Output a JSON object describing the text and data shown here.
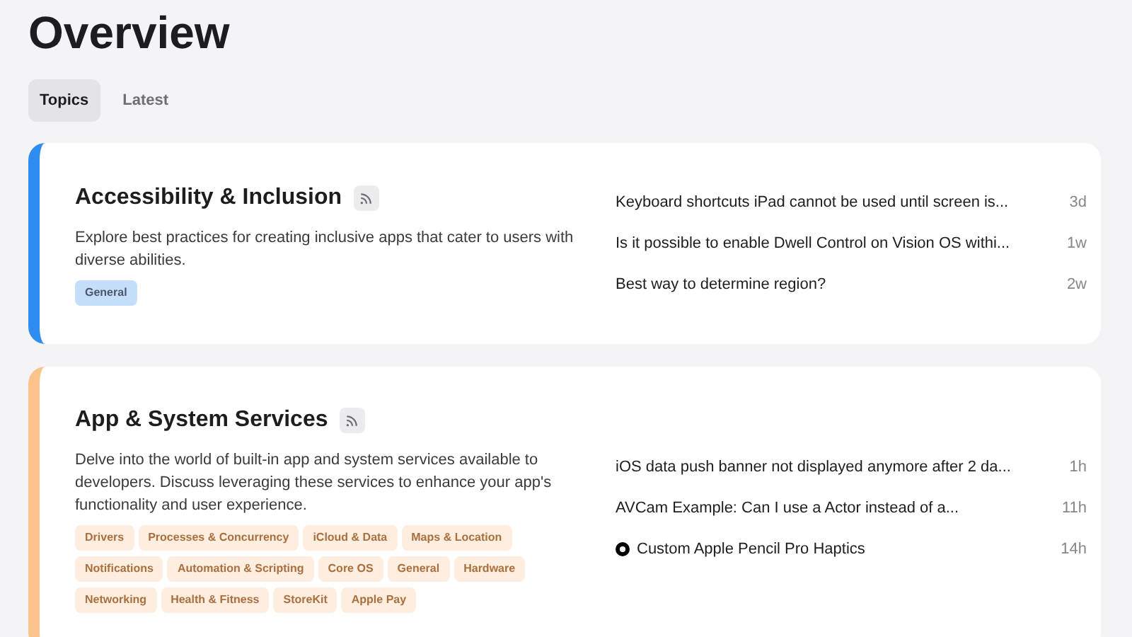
{
  "title": "Overview",
  "tabs": [
    {
      "label": "Topics",
      "selected": true
    },
    {
      "label": "Latest",
      "selected": false
    }
  ],
  "cards": [
    {
      "title": "Accessibility & Inclusion",
      "color": "#2f8cf0",
      "description": "Explore best practices for creating inclusive apps that cater to users with diverse abilities.",
      "tags": [
        "General"
      ],
      "posts": [
        {
          "kind": "plain",
          "title": "Keyboard shortcuts iPad cannot be used until screen is...",
          "age": "3d"
        },
        {
          "kind": "plain",
          "title": "Is it possible to enable Dwell Control on Vision OS withi...",
          "age": "1w"
        },
        {
          "kind": "plain",
          "title": "Best way to determine region?",
          "age": "2w"
        }
      ]
    },
    {
      "title": "App & System Services",
      "color": "#f9c48c",
      "description": "Delve into the world of built-in app and system services available to developers. Discuss leveraging these services to enhance your app's functionality and user experience.",
      "tags": [
        "Drivers",
        "Processes & Concurrency",
        "iCloud & Data",
        "Maps & Location",
        "Notifications",
        "Automation & Scripting",
        "Core OS",
        "General",
        "Hardware",
        "Networking",
        "Health & Fitness",
        "StoreKit",
        "Apple Pay"
      ],
      "posts": [
        {
          "kind": "plain",
          "title": "iOS data push banner not displayed anymore after 2 da...",
          "age": "1h"
        },
        {
          "kind": "plain",
          "title": "AVCam Example: Can I use a Actor instead of a...",
          "age": "11h"
        },
        {
          "kind": "marked",
          "title": "Custom Apple Pencil Pro Haptics",
          "age": "14h"
        }
      ]
    }
  ]
}
